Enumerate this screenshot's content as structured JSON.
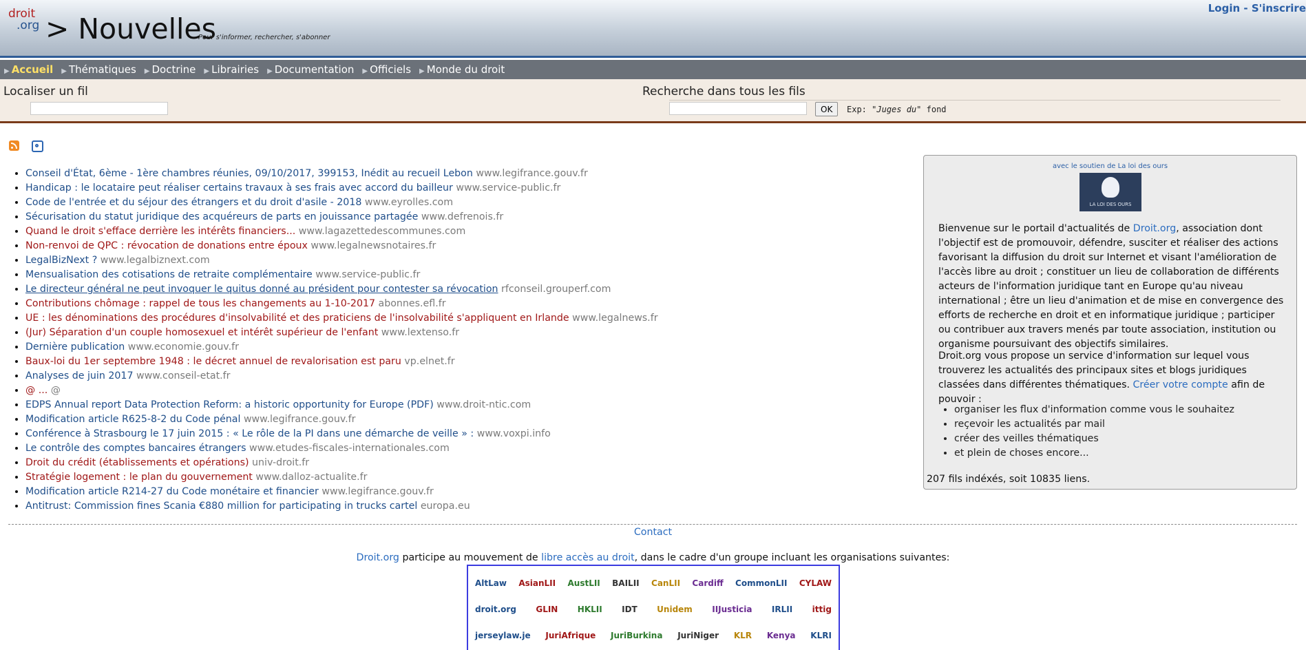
{
  "header": {
    "logo_droit": "droit",
    "logo_org": ".org",
    "title": "> Nouvelles",
    "tagline": "Pour s'informer, rechercher, s'abonner",
    "login": "Login",
    "separator": "-",
    "signup": "S'inscrire"
  },
  "nav": {
    "items": [
      "Accueil",
      "Thématiques",
      "Doctrine",
      "Librairies",
      "Documentation",
      "Officiels",
      "Monde du droit"
    ]
  },
  "search": {
    "locate_label": "Localiser un fil",
    "search_all_label": "Recherche dans tous les fils",
    "ok_label": "OK",
    "example_prefix": "Exp:",
    "example_query": "\"Juges du\"",
    "example_suffix": "fond"
  },
  "icons": {
    "rss": "rss-icon",
    "circle": "circle-icon"
  },
  "news": [
    {
      "title": "Conseil d'État, 6ème - 1ère chambres réunies, 09/10/2017, 399153, Inédit au recueil Lebon",
      "source": "www.legifrance.gouv.fr",
      "color": "blue"
    },
    {
      "title": "Handicap : le locataire peut réaliser certains travaux à ses frais avec accord du bailleur",
      "source": "www.service-public.fr",
      "color": "blue"
    },
    {
      "title": "Code de l'entrée et du séjour des étrangers et du droit d'asile - 2018",
      "source": "www.eyrolles.com",
      "color": "blue"
    },
    {
      "title": "Sécurisation du statut juridique des acquéreurs de parts en jouissance partagée",
      "source": "www.defrenois.fr",
      "color": "blue"
    },
    {
      "title": "Quand le droit s'efface derrière les intérêts financiers...",
      "source": "www.lagazettedescommunes.com",
      "color": "red"
    },
    {
      "title": "Non-renvoi de QPC : révocation de donations entre époux",
      "source": "www.legalnewsnotaires.fr",
      "color": "red"
    },
    {
      "title": "LegalBizNext ?",
      "source": "www.legalbiznext.com",
      "color": "blue"
    },
    {
      "title": "Mensualisation des cotisations de retraite complémentaire",
      "source": "www.service-public.fr",
      "color": "blue"
    },
    {
      "title": "Le directeur général ne peut invoquer le quitus donné au président pour contester sa révocation",
      "source": "rfconseil.grouperf.com",
      "color": "blue",
      "underline": true
    },
    {
      "title": "Contributions chômage : rappel de tous les changements au 1-10-2017",
      "source": "abonnes.efl.fr",
      "color": "red"
    },
    {
      "title": "UE : les dénominations des procédures d'insolvabilité et des praticiens de l'insolvabilité s'appliquent en Irlande",
      "source": "www.legalnews.fr",
      "color": "red"
    },
    {
      "title": "(Jur) Séparation d'un couple homosexuel et intérêt supérieur de l'enfant",
      "source": "www.lextenso.fr",
      "color": "red"
    },
    {
      "title": "Dernière publication",
      "source": "www.economie.gouv.fr",
      "color": "blue"
    },
    {
      "title": "Baux-loi du 1er septembre 1948 : le décret annuel de revalorisation est paru",
      "source": "vp.elnet.fr",
      "color": "red"
    },
    {
      "title": "Analyses de juin 2017",
      "source": "www.conseil-etat.fr",
      "color": "blue"
    },
    {
      "title": "@ ...",
      "source": "@",
      "color": "red"
    },
    {
      "title": "EDPS Annual report Data Protection Reform: a historic opportunity for Europe (PDF)",
      "source": "www.droit-ntic.com",
      "color": "blue"
    },
    {
      "title": "Modification article R625-8-2 du Code pénal",
      "source": "www.legifrance.gouv.fr",
      "color": "blue"
    },
    {
      "title": "Conférence à Strasbourg le 17 juin 2015 : « Le rôle de la PI dans une démarche de veille » :",
      "source": "www.voxpi.info",
      "color": "blue"
    },
    {
      "title": "Le contrôle des comptes bancaires étrangers",
      "source": "www.etudes-fiscales-internationales.com",
      "color": "blue"
    },
    {
      "title": "Droit du crédit (établissements et opérations)",
      "source": "univ-droit.fr",
      "color": "red"
    },
    {
      "title": "Stratégie logement : le plan du gouvernement",
      "source": "www.dalloz-actualite.fr",
      "color": "red"
    },
    {
      "title": "Modification article R214-27 du Code monétaire et financier",
      "source": "www.legifrance.gouv.fr",
      "color": "blue"
    },
    {
      "title": "Antitrust: Commission fines Scania €880 million for participating in trucks cartel",
      "source": "europa.eu",
      "color": "blue"
    }
  ],
  "sidebar": {
    "sponsor_text": "avec le soutien de La loi des ours",
    "sponsor_logo_caption": "LA LOI DES OURS",
    "intro_1_before": "Bienvenue sur le portail d'actualités de ",
    "intro_1_link": "Droit.org",
    "intro_1_after": ", association dont l'objectif est de promouvoir, défendre, susciter et réaliser des actions favorisant la diffusion du droit sur Internet et visant l'amélioration de l'accès libre au droit ; constituer un lieu de collaboration de différents acteurs de l'information juridique tant en Europe qu'au niveau international ; être un lieu d'animation et de mise en convergence des efforts de recherche en droit et en informatique juridique ; participer ou contribuer aux travers menés par toute association, institution ou organisme poursuivant des objectifs similaires.",
    "intro_2_before": "Droit.org vous propose un service d'information sur lequel vous trouverez les actualités des principaux sites et blogs juridiques classées dans différentes thématiques. ",
    "intro_2_link": "Créer votre compte",
    "intro_2_after": " afin de pouvoir :",
    "features": [
      "organiser les flux d'information comme vous le souhaitez",
      "reçevoir les actualités par mail",
      "créer des veilles thématiques",
      "et plein de choses encore..."
    ],
    "stats": "207 fils indéxés, soit 10835 liens."
  },
  "footer": {
    "contact": "Contact",
    "movement_link1": "Droit.org",
    "movement_text1": " participe au mouvement de ",
    "movement_link2": "libre accès au droit",
    "movement_text2": ", dans le cadre d'un groupe incluant les organisations suivantes:",
    "logos_row1": [
      "AltLaw",
      "AsianLII",
      "AustLII",
      "BAILII",
      "CanLII",
      "Cardiff",
      "CommonLII",
      "CYLAW"
    ],
    "logos_row2": [
      "droit.org",
      "GLIN",
      "HKLII",
      "IDT",
      "Unidem",
      "IIJusticia",
      "IRLII",
      "ittig"
    ],
    "logos_row3": [
      "jerseylaw.je",
      "JuriAfrique",
      "JuriBurkina",
      "JuriNiger",
      "KLR",
      "Kenya",
      "KLRI"
    ]
  }
}
